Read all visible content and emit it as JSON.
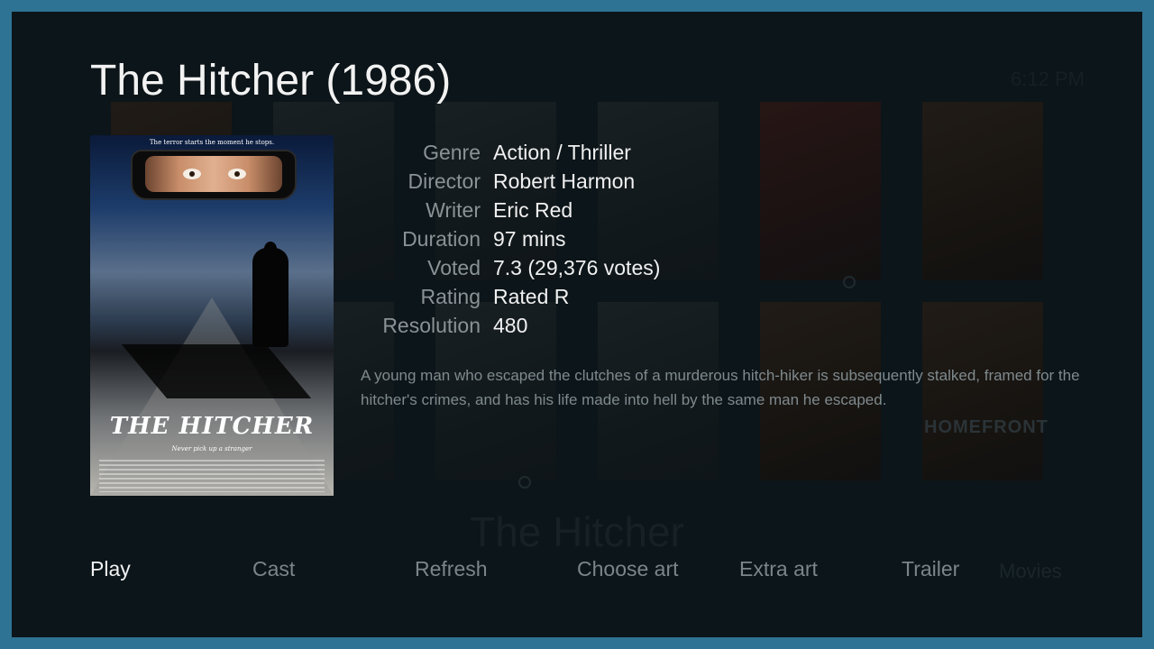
{
  "movie": {
    "title": "The Hitcher (1986)",
    "plot": "A young man who escaped the clutches of a murderous hitch-hiker is subsequently stalked, framed for the hitcher's crimes, and has his life made into hell by the same man he escaped."
  },
  "poster": {
    "tagline": "The terror starts the moment he stops.",
    "logo_text": "THE HITCHER",
    "subtag": "Never pick up a stranger"
  },
  "details": [
    {
      "label": "Genre",
      "value": "Action / Thriller"
    },
    {
      "label": "Director",
      "value": "Robert Harmon"
    },
    {
      "label": "Writer",
      "value": "Eric Red"
    },
    {
      "label": "Duration",
      "value": "97 mins"
    },
    {
      "label": "Voted",
      "value": "7.3 (29,376 votes)"
    },
    {
      "label": "Rating",
      "value": "Rated R"
    },
    {
      "label": "Resolution",
      "value": "480"
    }
  ],
  "menu": [
    {
      "label": "Play",
      "active": true
    },
    {
      "label": "Cast",
      "active": false
    },
    {
      "label": "Refresh",
      "active": false
    },
    {
      "label": "Choose art",
      "active": false
    },
    {
      "label": "Extra art",
      "active": false
    },
    {
      "label": "Trailer",
      "active": false
    }
  ],
  "background": {
    "title": "The Hitcher",
    "clock": "6:12 PM",
    "section": "Movies",
    "poster_text": "HOMEFRONT"
  },
  "colors": {
    "border": "#2e7394",
    "panel": "#0c1519",
    "label": "#8a9296",
    "value": "#f0f0f0",
    "menu_active": "#f2f2f2",
    "menu_inactive": "#7b858a"
  }
}
